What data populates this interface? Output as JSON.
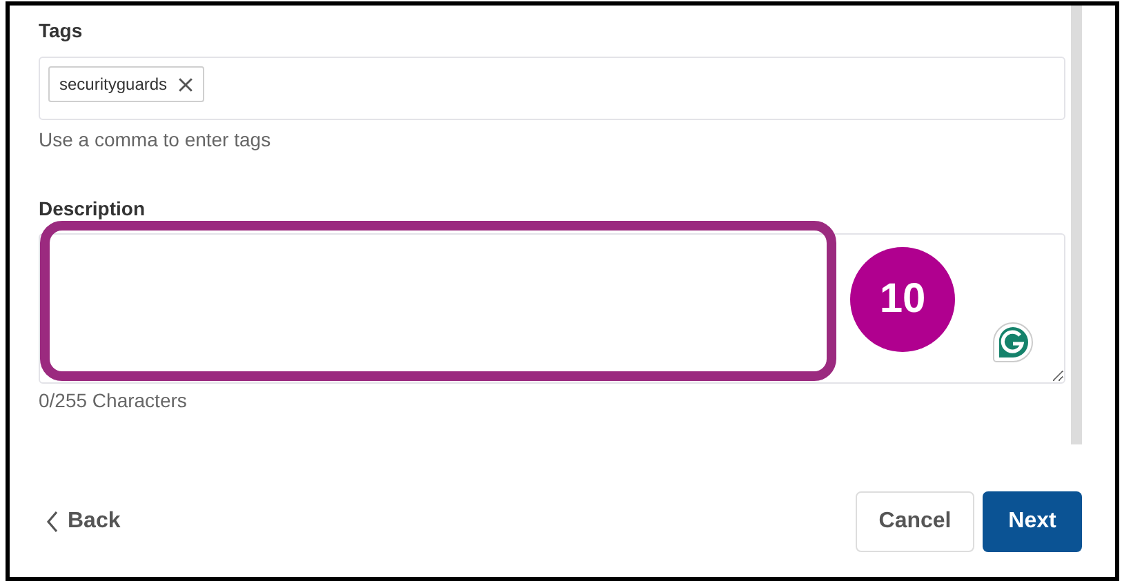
{
  "tags_field": {
    "label": "Tags",
    "tags": [
      {
        "text": "securityguards"
      }
    ],
    "hint": "Use a comma to enter tags"
  },
  "description_field": {
    "label": "Description",
    "counter": "0/255 Characters"
  },
  "annotation": {
    "step": "10"
  },
  "footer": {
    "back": "Back",
    "cancel": "Cancel",
    "next": "Next"
  }
}
